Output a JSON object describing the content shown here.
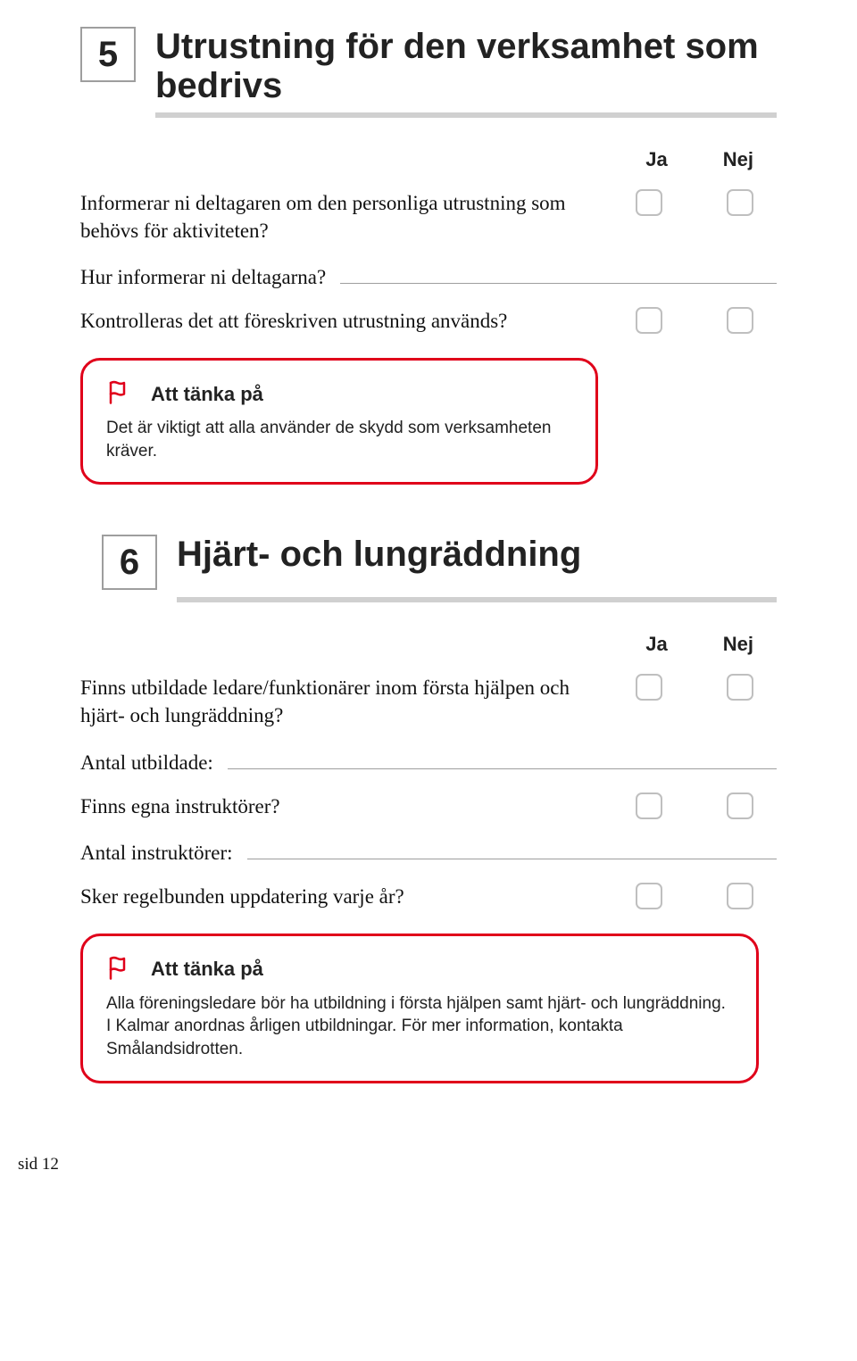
{
  "cols": {
    "ja": "Ja",
    "nej": "Nej"
  },
  "section5": {
    "number": "5",
    "title": "Utrustning för den verksamhet som bedrivs",
    "q1": "Informerar ni deltagaren om den personliga utrustning som behövs för aktiviteten?",
    "q2_label": "Hur informerar ni deltagarna?",
    "q3": "Kontrolleras det att föreskriven utrustning används?",
    "callout": {
      "title": "Att tänka på",
      "body": "Det är viktigt att alla använder de skydd som verksamheten kräver."
    }
  },
  "section6": {
    "number": "6",
    "title": "Hjärt- och lungräddning",
    "q1": "Finns utbildade ledare/funktionärer inom första hjälpen och hjärt- och lungräddning?",
    "q2_label": "Antal utbildade:",
    "q3": "Finns egna instruktörer?",
    "q4_label": "Antal instruktörer:",
    "q5": "Sker regelbunden uppdatering varje år?",
    "callout": {
      "title": "Att tänka på",
      "body": "Alla föreningsledare bör ha utbildning i första hjälpen samt hjärt- och lungräddning. I Kalmar anordnas årligen utbildningar. För mer information, kontakta Smålandsidrotten."
    }
  },
  "page": "sid 12"
}
